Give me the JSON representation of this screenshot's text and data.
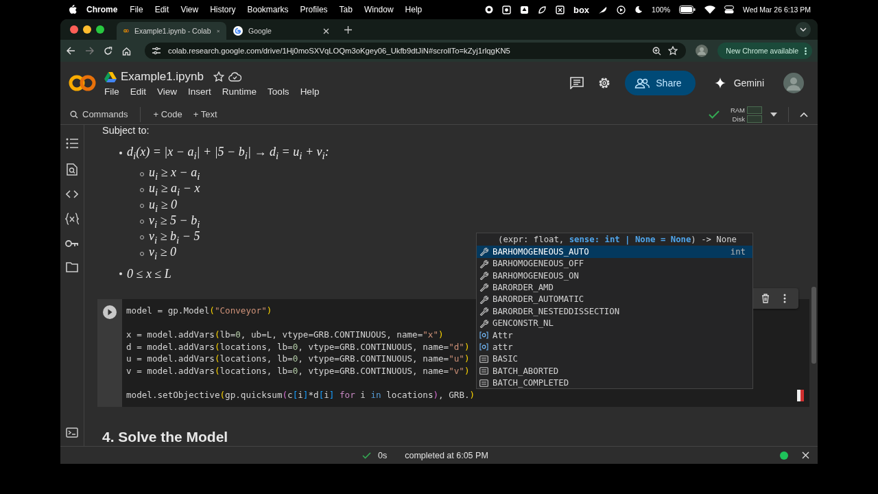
{
  "menubar": {
    "app": "Chrome",
    "menus": [
      "File",
      "Edit",
      "View",
      "History",
      "Bookmarks",
      "Profiles",
      "Tab",
      "Window",
      "Help"
    ],
    "box": "box",
    "battery": "100%",
    "clock": "Wed Mar 26  6:13 PM"
  },
  "tabs": [
    {
      "title": "Example1.ipynb - Colab",
      "selected": true
    },
    {
      "title": "Google",
      "selected": false
    }
  ],
  "address": {
    "url": "colab.research.google.com/drive/1Hj0moSXVqLOQm3oKgey06_Ukfb9dtJiN#scrollTo=kZyj1rlqgKN5",
    "update_button": "New Chrome available"
  },
  "notebook": {
    "title": "Example1.ipynb",
    "menus": [
      "File",
      "Edit",
      "View",
      "Insert",
      "Runtime",
      "Tools",
      "Help"
    ],
    "share": "Share",
    "gemini": "Gemini"
  },
  "toolbar": {
    "commands": "Commands",
    "add_code": "+ Code",
    "add_text": "+ Text",
    "ram": "RAM",
    "disk": "Disk"
  },
  "markdown": {
    "intro": "Subject to:",
    "bullets": [
      {
        "text": "d$_{i}$(x) = |x − a$_{i}$| + |5 − b$_{i}$| → d$_{i}$ = u$_{i}$ + v$_{i}$:",
        "children": [
          {
            "text": "u$_{i}$ ≥ x − a$_{i}$"
          },
          {
            "text": "u$_{i}$ ≥ a$_{i}$ − x"
          },
          {
            "text": "u$_{i}$ ≥ 0"
          },
          {
            "text": "v$_{i}$ ≥ 5 − b$_{i}$"
          },
          {
            "text": "v$_{i}$ ≥ b$_{i}$ − 5"
          },
          {
            "text": "v$_{i}$ ≥ 0"
          }
        ]
      },
      {
        "text": "0 ≤ x ≤ L"
      }
    ]
  },
  "code_cell": {
    "lines": [
      {
        "blank_before": false,
        "tokens": [
          {
            "text": "model = gp.Model",
            "kind": "plain"
          },
          {
            "text": "(",
            "kind": "p1"
          },
          {
            "text": "\"Conveyor\"",
            "kind": "str"
          },
          {
            "text": ")",
            "kind": "p1"
          }
        ]
      },
      {
        "blank_before": true,
        "tokens": [
          {
            "text": "x = model.addVars",
            "kind": "plain"
          },
          {
            "text": "(",
            "kind": "p1"
          },
          {
            "text": "lb=",
            "kind": "plain"
          },
          {
            "text": "0",
            "kind": "num"
          },
          {
            "text": ", ub=L, vtype=GRB.CONTINUOUS, name=",
            "kind": "plain"
          },
          {
            "text": "\"x\"",
            "kind": "str"
          },
          {
            "text": ")",
            "kind": "p1"
          }
        ]
      },
      {
        "blank_before": false,
        "tokens": [
          {
            "text": "d = model.addVars",
            "kind": "plain"
          },
          {
            "text": "(",
            "kind": "p1"
          },
          {
            "text": "locations, lb=",
            "kind": "plain"
          },
          {
            "text": "0",
            "kind": "num"
          },
          {
            "text": ", vtype=GRB.CONTINUOUS, name=",
            "kind": "plain"
          },
          {
            "text": "\"d\"",
            "kind": "str"
          },
          {
            "text": ")",
            "kind": "p1"
          }
        ]
      },
      {
        "blank_before": false,
        "tokens": [
          {
            "text": "u = model.addVars",
            "kind": "plain"
          },
          {
            "text": "(",
            "kind": "p1"
          },
          {
            "text": "locations, lb=",
            "kind": "plain"
          },
          {
            "text": "0",
            "kind": "num"
          },
          {
            "text": ", vtype=GRB.CONTINUOUS, name=",
            "kind": "plain"
          },
          {
            "text": "\"u\"",
            "kind": "str"
          },
          {
            "text": ")",
            "kind": "p1"
          }
        ]
      },
      {
        "blank_before": false,
        "tokens": [
          {
            "text": "v = model.addVars",
            "kind": "plain"
          },
          {
            "text": "(",
            "kind": "p1"
          },
          {
            "text": "locations, lb=",
            "kind": "plain"
          },
          {
            "text": "0",
            "kind": "num"
          },
          {
            "text": ", vtype=GRB.CONTINUOUS, name=",
            "kind": "plain"
          },
          {
            "text": "\"v\"",
            "kind": "str"
          },
          {
            "text": ")",
            "kind": "p1"
          }
        ]
      },
      {
        "blank_before": true,
        "tokens": [
          {
            "text": "model.setObjective",
            "kind": "plain"
          },
          {
            "text": "(",
            "kind": "p1"
          },
          {
            "text": "gp.quicksum",
            "kind": "plain"
          },
          {
            "text": "(",
            "kind": "p2"
          },
          {
            "text": "c",
            "kind": "plain"
          },
          {
            "text": "[",
            "kind": "p3"
          },
          {
            "text": "i",
            "kind": "plain"
          },
          {
            "text": "]",
            "kind": "p3"
          },
          {
            "text": "*d",
            "kind": "plain"
          },
          {
            "text": "[",
            "kind": "p3"
          },
          {
            "text": "i",
            "kind": "plain"
          },
          {
            "text": "]",
            "kind": "p3"
          },
          {
            "text": " for",
            "kind": "kw"
          },
          {
            "text": " i ",
            "kind": "plain"
          },
          {
            "text": "in",
            "kind": "kw2"
          },
          {
            "text": " locations",
            "kind": "plain"
          },
          {
            "text": ")",
            "kind": "p2"
          },
          {
            "text": ", GRB.",
            "kind": "plain"
          },
          {
            "text": ")",
            "kind": "p1"
          }
        ]
      }
    ]
  },
  "autocomplete": {
    "signature": [
      {
        "text": "(expr: float, ",
        "kind": "plain"
      },
      {
        "text": "sense: int | None = None",
        "kind": "param"
      },
      {
        "text": ") -> None",
        "kind": "plain"
      }
    ],
    "items": [
      {
        "label": "BARHOMOGENEOUS_AUTO",
        "kind": "constant",
        "selected": true,
        "detail": "int"
      },
      {
        "label": "BARHOMOGENEOUS_OFF",
        "kind": "constant",
        "selected": false
      },
      {
        "label": "BARHOMOGENEOUS_ON",
        "kind": "constant",
        "selected": false
      },
      {
        "label": "BARORDER_AMD",
        "kind": "constant",
        "selected": false
      },
      {
        "label": "BARORDER_AUTOMATIC",
        "kind": "constant",
        "selected": false
      },
      {
        "label": "BARORDER_NESTEDDISSECTION",
        "kind": "constant",
        "selected": false
      },
      {
        "label": "GENCONSTR_NL",
        "kind": "constant",
        "selected": false
      },
      {
        "label": "Attr",
        "kind": "variable",
        "selected": false
      },
      {
        "label": "attr",
        "kind": "variable",
        "selected": false
      },
      {
        "label": "BASIC",
        "kind": "enum",
        "selected": false
      },
      {
        "label": "BATCH_ABORTED",
        "kind": "enum",
        "selected": false
      },
      {
        "label": "BATCH_COMPLETED",
        "kind": "enum",
        "selected": false
      }
    ]
  },
  "heading": "4. Solve the Model",
  "status": {
    "duration": "0s",
    "message": "completed at 6:05 PM"
  }
}
